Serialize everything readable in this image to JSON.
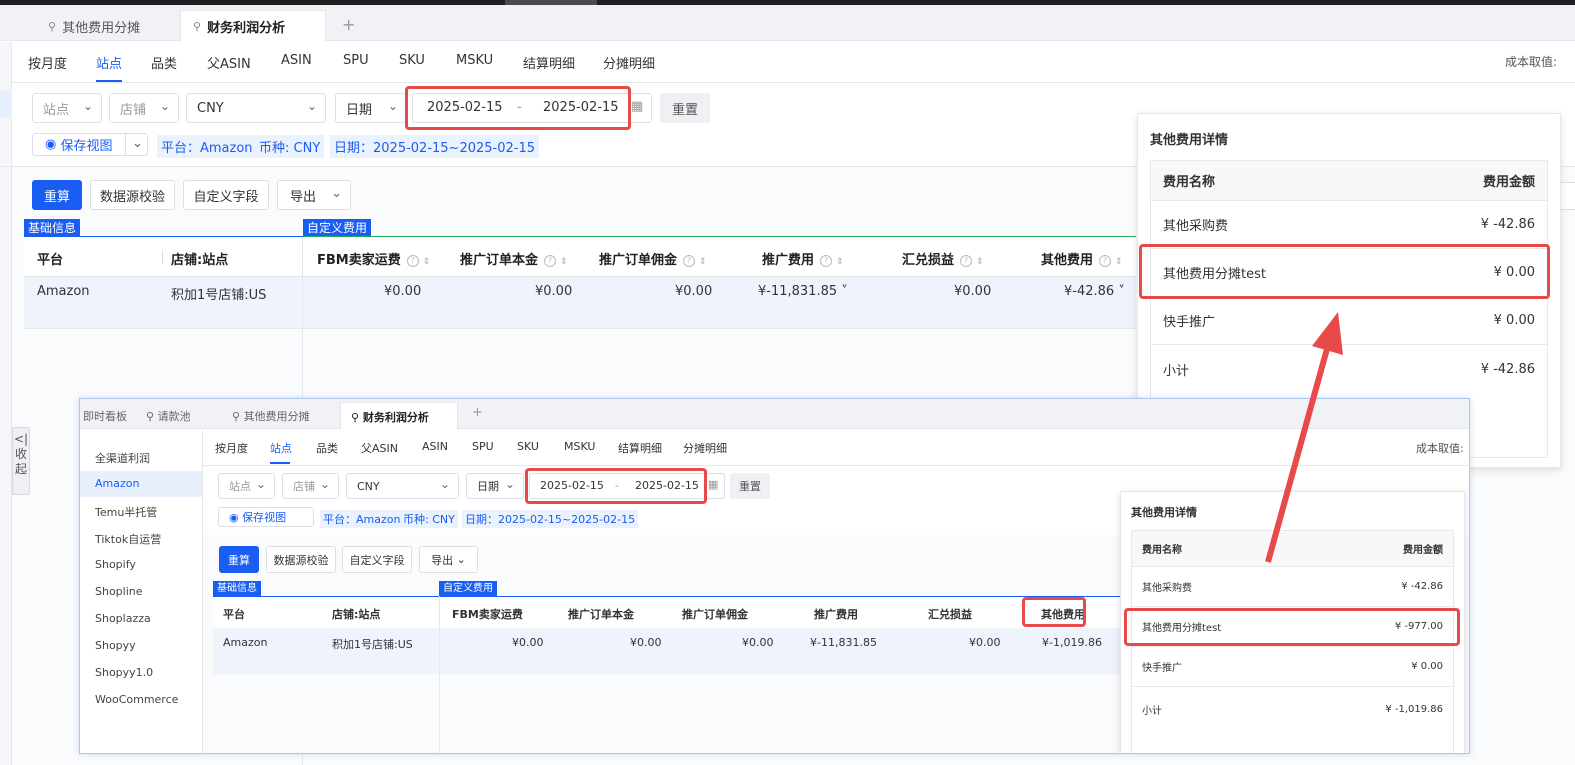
{
  "tabs": [
    {
      "label": "其他费用分摊"
    },
    {
      "label": "财务利润分析"
    }
  ],
  "add_tab": "+",
  "subnav": [
    "按月度",
    "站点",
    "品类",
    "父ASIN",
    "ASIN",
    "SPU",
    "SKU",
    "MSKU",
    "结算明细",
    "分摊明细"
  ],
  "cost_label": "成本取值:",
  "filters": {
    "site_placeholder": "站点",
    "store_placeholder": "店铺",
    "currency": "CNY",
    "date_type": "日期",
    "date_start": "2025-02-15",
    "date_sep": "-",
    "date_end": "2025-02-15",
    "reset": "重置",
    "save_view": "保存视图",
    "tag_platform": "平台：Amazon",
    "tag_currency": "币种: CNY",
    "tag_date": "日期：2025-02-15~2025-02-15"
  },
  "actions": {
    "recalc": "重算",
    "validate": "数据源校验",
    "custom_fields": "自定义字段",
    "export": "导出"
  },
  "sections": {
    "basic": "基础信息",
    "custom": "自定义费用"
  },
  "table": {
    "headers": [
      "平台",
      "店铺:站点",
      "FBM卖家运费",
      "推广订单本金",
      "推广订单佣金",
      "推广费用",
      "汇兑损益",
      "其他费用"
    ],
    "row": [
      "Amazon",
      "积加1号店铺:US",
      "¥0.00",
      "¥0.00",
      "¥0.00",
      "¥-11,831.85",
      "¥0.00",
      "¥-42.86"
    ]
  },
  "detail": {
    "title": "其他费用详情",
    "col_name": "费用名称",
    "col_amount": "费用金额",
    "rows": [
      {
        "name": "其他采购费",
        "amount": "¥ -42.86"
      },
      {
        "name": "其他费用分摊test",
        "amount": "¥ 0.00"
      },
      {
        "name": "快手推广",
        "amount": "¥ 0.00"
      },
      {
        "name": "小计",
        "amount": "¥ -42.86"
      }
    ]
  },
  "collapse": "<| 收起",
  "inset": {
    "tabs": [
      "即时看板",
      "请款池",
      "其他费用分摊",
      "财务利润分析"
    ],
    "sidebar": [
      "全渠道利润",
      "Amazon",
      "Temu半托管",
      "Tiktok自运营",
      "Shopify",
      "Shopline",
      "Shoplazza",
      "Shopyy",
      "Shopyy1.0",
      "WooCommerce"
    ],
    "row": [
      "Amazon",
      "积加1号店铺:US",
      "¥0.00",
      "¥0.00",
      "¥0.00",
      "¥-11,831.85",
      "¥0.00",
      "¥-1,019.86"
    ],
    "detail_rows": [
      {
        "name": "其他采购费",
        "amount": "¥ -42.86"
      },
      {
        "name": "其他费用分摊test",
        "amount": "¥ -977.00"
      },
      {
        "name": "快手推广",
        "amount": "¥ 0.00"
      },
      {
        "name": "小计",
        "amount": "¥ -1,019.86"
      }
    ]
  },
  "colors": {
    "accent": "#1a5df2",
    "highlight": "#e84a4a"
  }
}
